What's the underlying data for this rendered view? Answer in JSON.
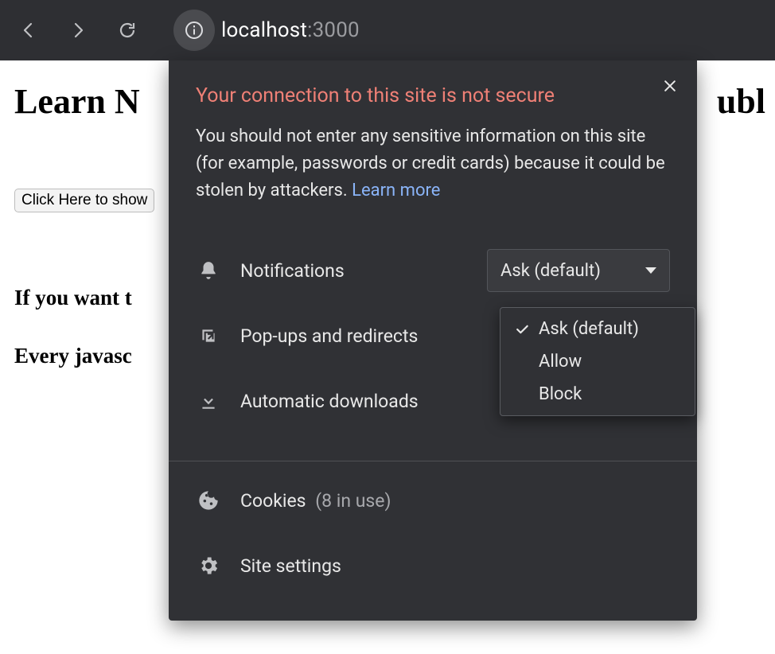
{
  "url": {
    "host": "localhost",
    "port": ":3000"
  },
  "page": {
    "h1_visible": "Learn N",
    "h1_trail": "ubl",
    "button_visible": "Click Here to show",
    "h3a_visible": "If you want t",
    "h3b_visible": "Every javasc"
  },
  "popup": {
    "title": "Your connection to this site is not secure",
    "desc": "You should not enter any sensitive information on this site (for example, passwords or credit cards) because it could be stolen by attackers. ",
    "learn_more": "Learn more",
    "permissions": [
      {
        "label": "Notifications",
        "value": "Ask (default)"
      },
      {
        "label": "Pop-ups and redirects",
        "value": ""
      },
      {
        "label": "Automatic downloads",
        "value": ""
      }
    ],
    "dropdown": {
      "options": [
        "Ask (default)",
        "Allow",
        "Block"
      ],
      "selected_index": 0
    },
    "cookies_label": "Cookies",
    "cookies_sub": "(8 in use)",
    "site_settings": "Site settings"
  }
}
